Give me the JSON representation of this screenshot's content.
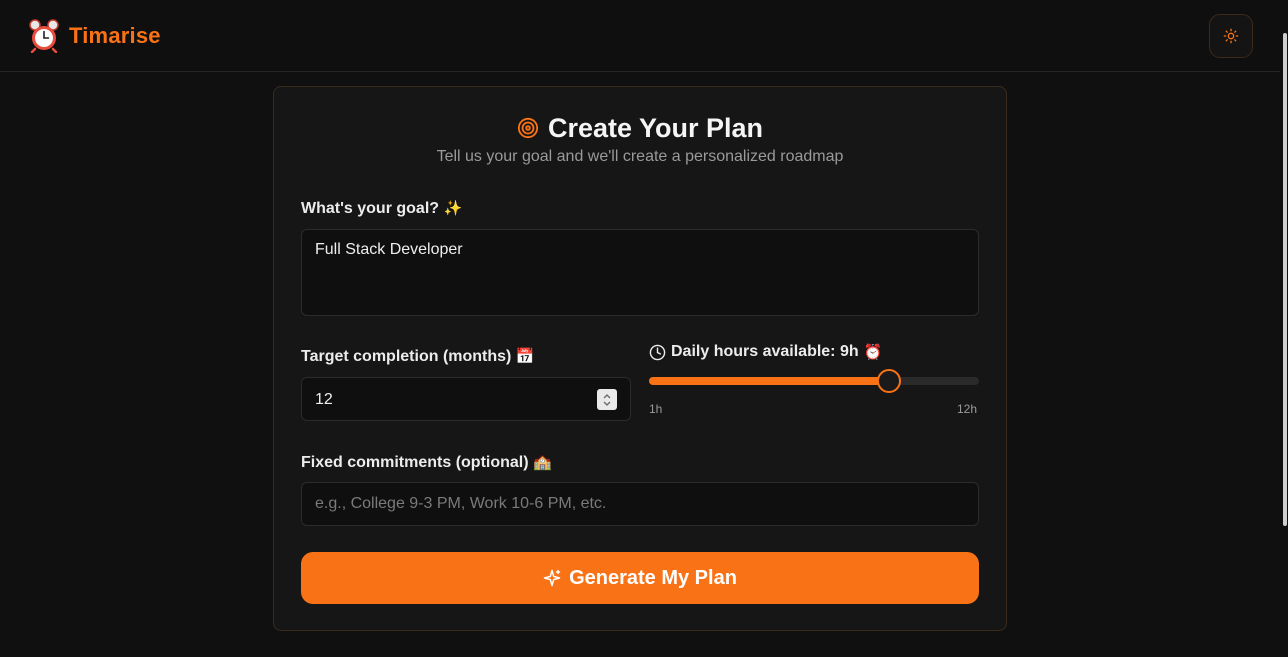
{
  "header": {
    "brand_name": "Timarise",
    "brand_icon": "alarm-clock-icon",
    "theme_toggle_icon": "sun-icon"
  },
  "form": {
    "title": "Create Your Plan",
    "title_icon": "target-icon",
    "subtitle": "Tell us your goal and we'll create a personalized roadmap",
    "goal": {
      "label": "What's your goal?",
      "label_emoji": "✨",
      "value": "Full Stack Developer"
    },
    "months": {
      "label": "Target completion (months)",
      "label_emoji": "📅",
      "value": "12"
    },
    "hours": {
      "label": "Daily hours available: 9h",
      "label_emoji": "⏰",
      "value": 9,
      "min": 1,
      "max": 12,
      "min_label": "1h",
      "max_label": "12h"
    },
    "commitments": {
      "label": "Fixed commitments (optional)",
      "label_emoji": "🏫",
      "placeholder": "e.g., College 9-3 PM, Work 10-6 PM, etc."
    },
    "submit": {
      "label": "Generate My Plan",
      "icon": "sparkle-icon"
    }
  },
  "colors": {
    "accent": "#f97316",
    "background": "#101010",
    "card": "#161616"
  }
}
